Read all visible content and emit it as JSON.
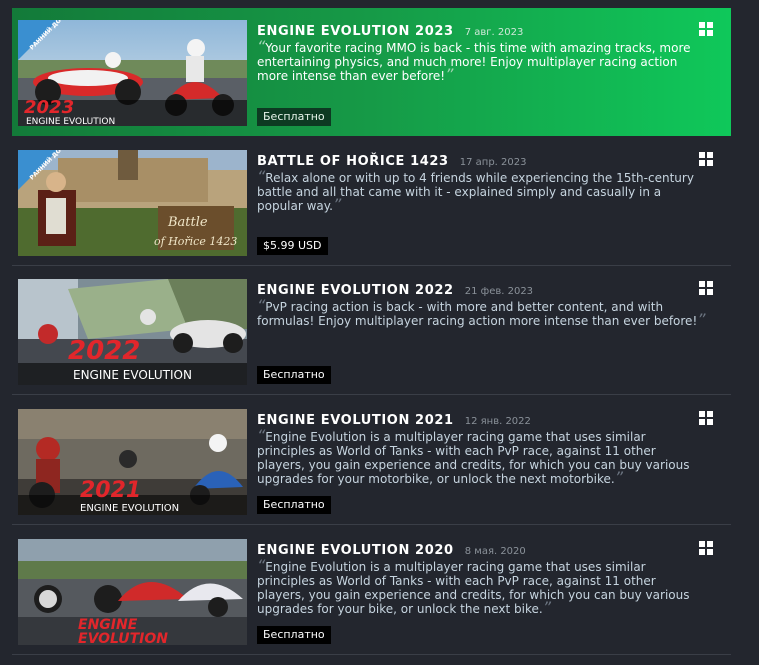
{
  "games": [
    {
      "title": "ENGINE EVOLUTION 2023",
      "date": "7 авг. 2023",
      "description": "Your favorite racing MMO is back - this time with amazing tracks, more entertaining physics, and much more! Enjoy multiplayer racing action more intense than ever before!",
      "price": "Бесплатно",
      "platform_icon": "windows-icon",
      "capsule_logo": "2023",
      "capsule_caption": "ENGINE EVOLUTION",
      "capsule_badge": "РАННИЙ ДОСТУП"
    },
    {
      "title": "BATTLE OF HOŘICE 1423",
      "date": "17 апр. 2023",
      "description": "Relax alone or with up to 4 friends while experiencing the 15th-century battle and all that came with it - explained simply and casually in a popular way.",
      "price": "$5.99 USD",
      "platform_icon": "windows-icon",
      "capsule_line1": "Battle",
      "capsule_line2": "of Hořice 1423",
      "capsule_badge": "РАННИЙ ДОСТУП"
    },
    {
      "title": "ENGINE EVOLUTION 2022",
      "date": "21 фев. 2023",
      "description": "PvP racing action is back - with more and better content, and with formulas! Enjoy multiplayer racing action more intense than ever before!",
      "price": "Бесплатно",
      "platform_icon": "windows-icon",
      "capsule_logo": "2022",
      "capsule_caption": "ENGINE EVOLUTION"
    },
    {
      "title": "ENGINE EVOLUTION 2021",
      "date": "12 янв. 2022",
      "description": "Engine Evolution is a multiplayer racing game that uses similar principles as World of Tanks - with each PvP race, against 11 other players, you gain experience and credits, for which you can buy various upgrades for your motorbike, or unlock the next motorbike.",
      "price": "Бесплатно",
      "platform_icon": "windows-icon",
      "capsule_logo": "2021",
      "capsule_caption": "ENGINE EVOLUTION"
    },
    {
      "title": "ENGINE EVOLUTION 2020",
      "date": "8 мая. 2020",
      "description": "Engine Evolution is a multiplayer racing game that uses similar principles as World of Tanks - with each PvP race, against 11 other players, you gain experience and credits, for which you can buy various upgrades for your bike, or unlock the next bike.",
      "price": "Бесплатно",
      "platform_icon": "windows-icon",
      "capsule_logo_line1": "ENGINE",
      "capsule_logo_line2": "EVOLUTION"
    }
  ],
  "colors": {
    "background": "#23262e",
    "highlight_start": "#137a39",
    "highlight_end": "#0fc85a",
    "logo_red": "#e2262b"
  }
}
